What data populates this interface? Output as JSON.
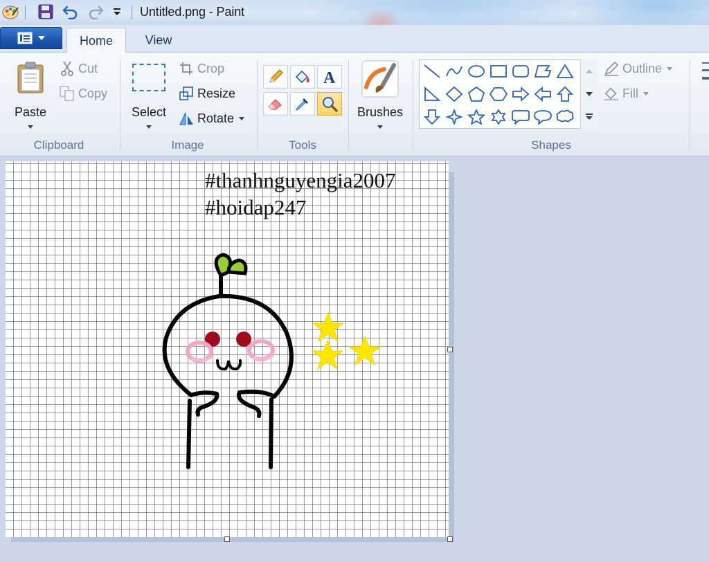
{
  "window": {
    "title": "Untitled.png - Paint"
  },
  "tabs": {
    "home": "Home",
    "view": "View"
  },
  "clipboard": {
    "paste": "Paste",
    "cut": "Cut",
    "copy": "Copy",
    "label": "Clipboard"
  },
  "image": {
    "select": "Select",
    "crop": "Crop",
    "resize": "Resize",
    "rotate": "Rotate",
    "label": "Image"
  },
  "tools": {
    "label": "Tools"
  },
  "brushes": {
    "label": "Brushes"
  },
  "shapes": {
    "outline": "Outline",
    "fill": "Fill",
    "label": "Shapes"
  },
  "canvas": {
    "text_line1": "#thanhnguyengia2007",
    "text_line2": "#hoidap247"
  },
  "colors": {
    "tab_blue": "#1c56ad",
    "leaf_green": "#9acd32",
    "star_yellow": "#ffe600",
    "cheek_pink": "#f4a6c8",
    "eye_red": "#9b0d1c",
    "shape_blue": "#2a61b5"
  }
}
